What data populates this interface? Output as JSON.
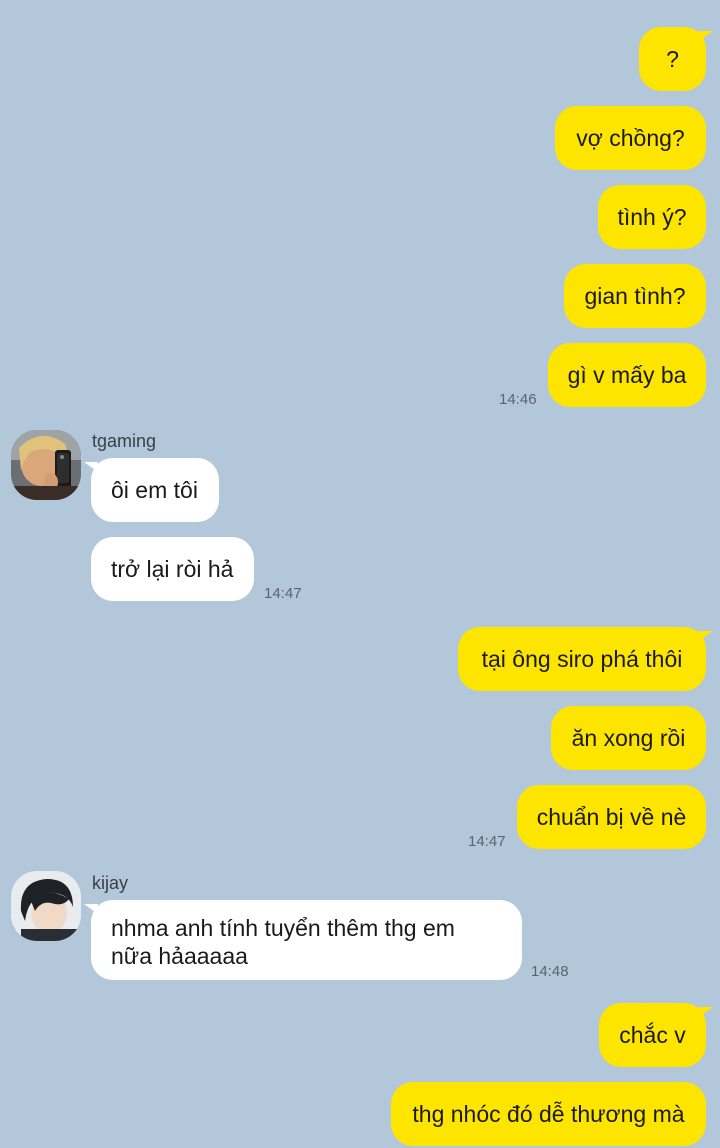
{
  "messages_block_1": [
    {
      "text": "?"
    },
    {
      "text": "vợ chồng?"
    },
    {
      "text": "tình ý?"
    },
    {
      "text": "gian tình?"
    },
    {
      "text": "gì v mấy ba"
    }
  ],
  "time_1": "14:46",
  "user_tgaming": {
    "name": "tgaming",
    "avatar_icon": "user-avatar-photo",
    "messages": [
      {
        "text": "ôi em tôi"
      },
      {
        "text": "trở lại ròi hả"
      }
    ],
    "time": "14:47"
  },
  "messages_block_2": [
    {
      "text": "tại ông siro phá thôi"
    },
    {
      "text": "ăn xong rồi"
    },
    {
      "text": "chuẩn bị về nè"
    }
  ],
  "time_2": "14:47",
  "user_kijay": {
    "name": "kijay",
    "avatar_icon": "user-avatar-photo",
    "messages": [
      {
        "text": "nhma anh tính tuyển thêm thg em nữa hảaaaaa"
      }
    ],
    "time": "14:48"
  },
  "messages_block_3": [
    {
      "text": "chắc v"
    },
    {
      "text": "thg nhóc đó dễ thương mà"
    }
  ],
  "colors": {
    "background": "#b2c7da",
    "my_bubble": "#fee500",
    "their_bubble": "#ffffff"
  }
}
